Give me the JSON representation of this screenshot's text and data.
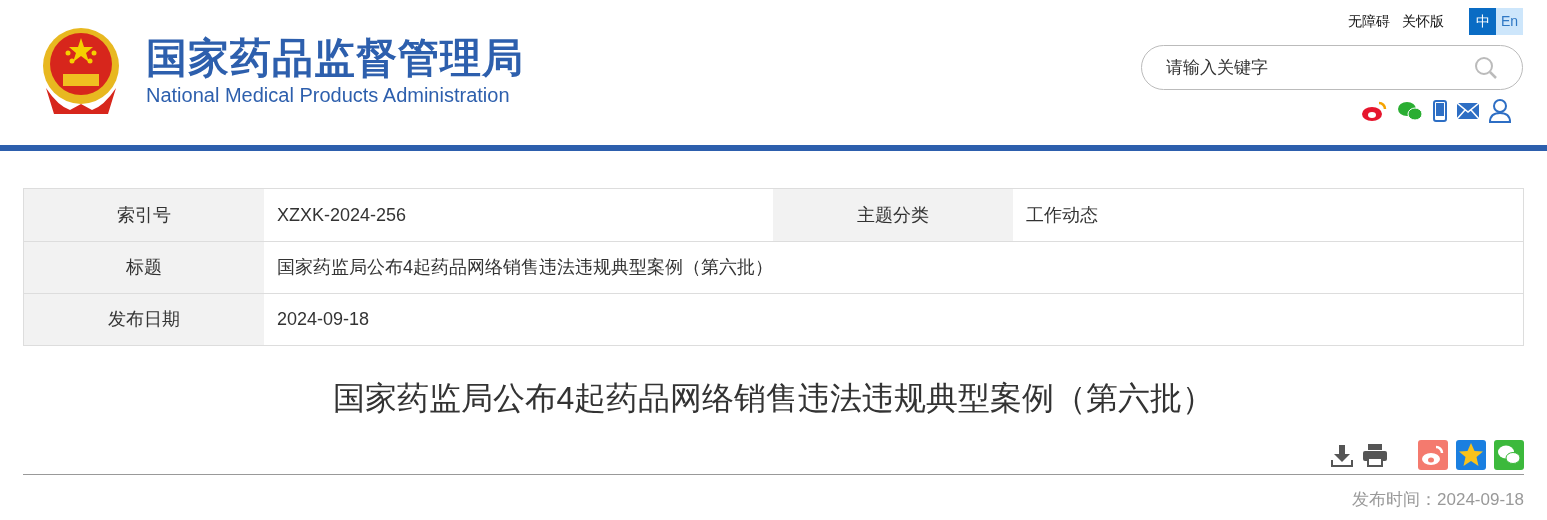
{
  "header": {
    "title": "国家药品监督管理局",
    "subtitle": "National Medical Products Administration",
    "links": [
      "无障碍",
      "关怀版"
    ],
    "languages": [
      {
        "label": "中",
        "selected": true
      },
      {
        "label": "En",
        "selected": false
      }
    ],
    "search": {
      "placeholder": "请输入关键字"
    }
  },
  "info_table": {
    "rows": [
      [
        {
          "label": "索引号",
          "value": "XZXK-2024-256"
        },
        {
          "label": "主题分类",
          "value": "工作动态"
        }
      ],
      [
        {
          "label": "标题",
          "value": "国家药监局公布4起药品网络销售违法违规典型案例（第六批）"
        }
      ],
      [
        {
          "label": "发布日期",
          "value": "2024-09-18"
        }
      ]
    ]
  },
  "article": {
    "title": "国家药监局公布4起药品网络销售违法违规典型案例（第六批）",
    "published": "发布时间：2024-09-18"
  }
}
